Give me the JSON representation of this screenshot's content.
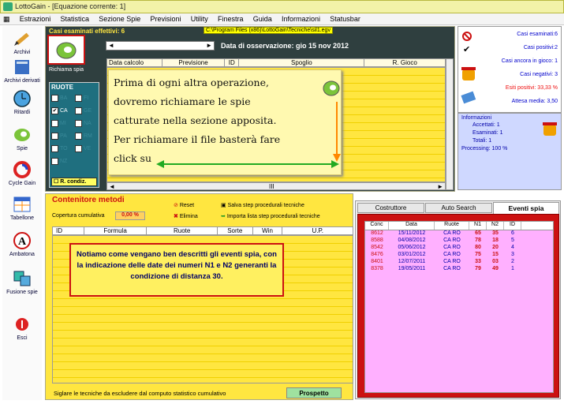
{
  "app": {
    "title": "LottoGain - [Equazione corrente: 1]"
  },
  "menu": [
    "Estrazioni",
    "Statistica",
    "Sezione Spie",
    "Previsioni",
    "Utility",
    "Finestra",
    "Guida",
    "Informazioni",
    "Statusbar"
  ],
  "sidebar": [
    {
      "label": "Archivi",
      "icon": "pencil-icon"
    },
    {
      "label": "Archivi derivati",
      "icon": "book-icon"
    },
    {
      "label": "Ritardi",
      "icon": "clock-icon"
    },
    {
      "label": "Spie",
      "icon": "ring-icon"
    },
    {
      "label": "Cycle Gain",
      "icon": "cycle-icon"
    },
    {
      "label": "Tabellone",
      "icon": "calendar-icon"
    },
    {
      "label": "Ambatona",
      "icon": "letter-a-icon"
    },
    {
      "label": "Fusione spie",
      "icon": "merge-icon"
    },
    {
      "label": "Esci",
      "icon": "exit-icon"
    }
  ],
  "top": {
    "casi_title": "Casi esaminati effettivi: 6",
    "path": "C:\\Program Files (x86)\\LottoGain\\Tecniche\\sil1.egv",
    "obs_label": "Data di osservazione:  gio 15 nov 2012",
    "richiama_label": "Richiama spia",
    "columns": [
      "Data calcolo",
      "Previsione",
      "ID",
      "Spoglio",
      "R. Gioco"
    ],
    "ruote_title": "RUOTE",
    "ruote": [
      [
        "BA",
        "FI"
      ],
      [
        "CA",
        "GE"
      ],
      [
        "MI",
        "NA"
      ],
      [
        "PA",
        "RM"
      ],
      [
        "TO",
        "VE"
      ],
      [
        "NZ",
        ""
      ]
    ],
    "ruote_checked": [
      "CA",
      "RO"
    ],
    "r_condiz": "R. condiz."
  },
  "callout": {
    "lines": [
      "Prima di ogni altra operazione,",
      "dovremo richiamare le spie",
      "catturate nella sezione apposita.",
      "Per richiamare il file basterà fare",
      "click su"
    ]
  },
  "stats": {
    "items": [
      {
        "label": "Casi esaminati:6",
        "icon": "forbidden-icon"
      },
      {
        "label": "Casi positivi:2",
        "icon": "check-icon"
      },
      {
        "label": "Casi ancora in gioco: 1",
        "icon": ""
      },
      {
        "label": "Casi negativi: 3",
        "icon": "pot-icon"
      },
      {
        "label": "Esiti positivi: 33,33 %",
        "icon": ""
      },
      {
        "label": "Attesa media: 3,50",
        "icon": "book-stack-icon"
      }
    ],
    "info_title": "Informazioni",
    "info": [
      {
        "k": "Accettati:",
        "v": "1"
      },
      {
        "k": "Esaminati:",
        "v": "1"
      },
      {
        "k": "Totali:",
        "v": "1"
      },
      {
        "k": "Processing:",
        "v": "100 %"
      }
    ]
  },
  "bottom": {
    "title": "Contenitore metodi",
    "cov_label": "Copertura cumulativa",
    "cov_value": "0,00 %",
    "reset": "Reset",
    "elimina": "Elimina",
    "salva": "Salva step procedurali tecniche",
    "importa": "Importa lista step procedurali tecniche",
    "columns": [
      "ID",
      "Formula",
      "Ruote",
      "Sorte",
      "Win",
      "U.P."
    ],
    "note": "Notiamo come vengano ben descritti gli eventi spia, con la indicazione delle date dei numeri N1 e N2 generanti la condizione di distanza 30.",
    "footer": "Siglare le tecniche da escludere dal computo statistico cumulativo",
    "prospetto": "Prospetto"
  },
  "right": {
    "tabs": [
      "Costruttore",
      "Auto Search",
      "Eventi spia"
    ],
    "active_tab": "Eventi spia",
    "columns": [
      "Conc",
      "Data",
      "Ruote",
      "N1",
      "N2",
      "ID"
    ],
    "rows": [
      [
        "8612",
        "15/11/2012",
        "CA RO",
        "65",
        "35",
        "6"
      ],
      [
        "8588",
        "04/08/2012",
        "CA RO",
        "78",
        "18",
        "5"
      ],
      [
        "8542",
        "05/06/2012",
        "CA RO",
        "80",
        "20",
        "4"
      ],
      [
        "8476",
        "03/01/2012",
        "CA RO",
        "75",
        "15",
        "3"
      ],
      [
        "8401",
        "12/07/2011",
        "CA RO",
        "33",
        "03",
        "2"
      ],
      [
        "8378",
        "19/05/2011",
        "CA RO",
        "79",
        "49",
        "1"
      ]
    ]
  }
}
